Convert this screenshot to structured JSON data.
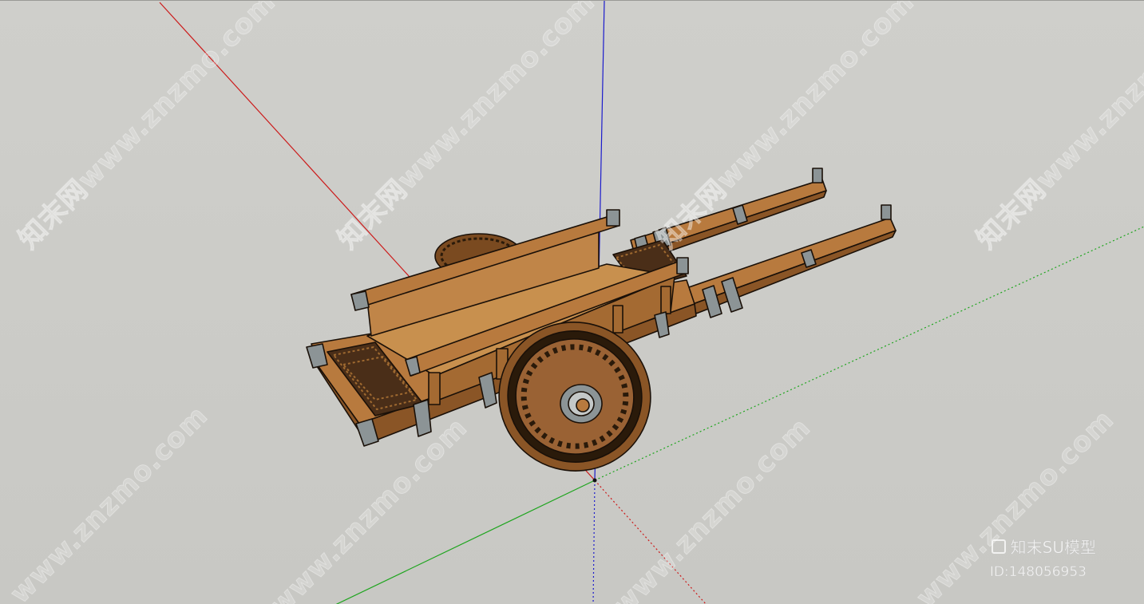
{
  "viewport": {
    "background": "#cbcbc7",
    "axes": {
      "red": "#cc1b1b",
      "green": "#1fa51f",
      "blue": "#1b1bcc"
    },
    "model": "wooden-handcart"
  },
  "watermarks": [
    "知末网www.znzmo.com",
    "知末网www.znzmo.com",
    "知末网www.znzmo.com",
    "知末网www.znzmo.com",
    "www.znzmo.com",
    "www.znzmo.com",
    "www.znzmo.com",
    "www.znzmo.com"
  ],
  "brand": {
    "name": "知末SU模型",
    "id": "ID:148056953"
  },
  "colors": {
    "wood": "#b87a3e",
    "wood_dark": "#8a5526",
    "wood_light": "#c8904e",
    "metal": "#8c9496",
    "grate": "#4a2e18"
  }
}
